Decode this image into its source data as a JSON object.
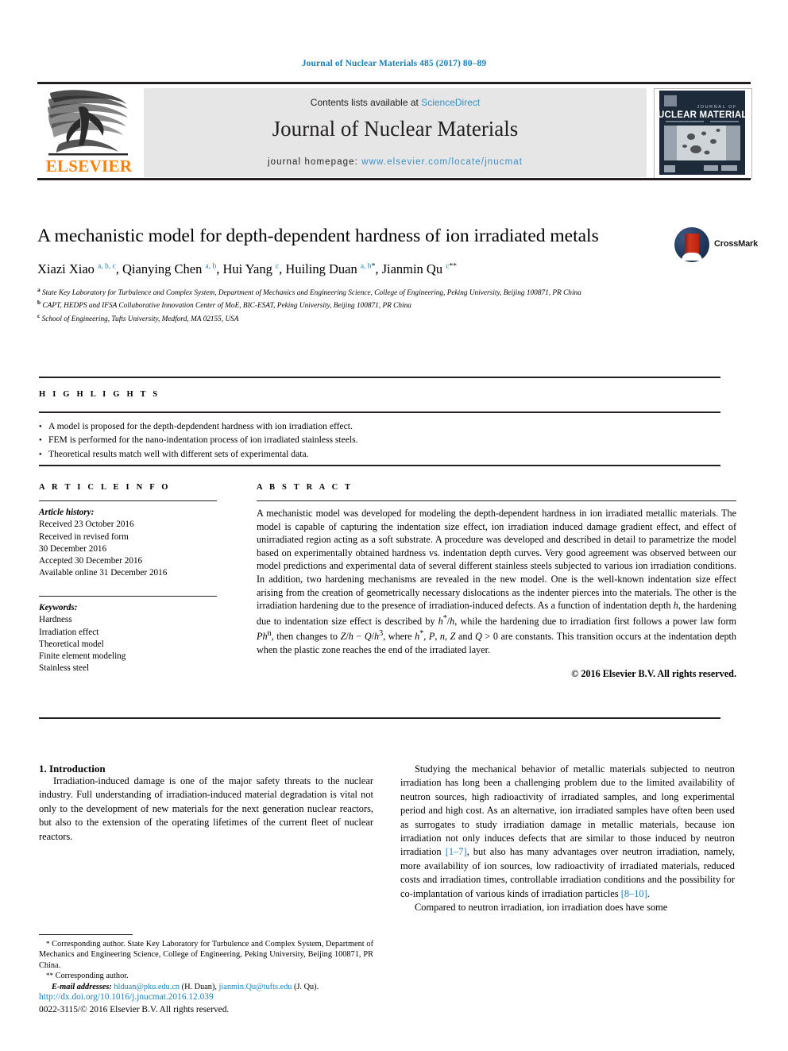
{
  "running_head": "Journal of Nuclear Materials 485 (2017) 80–89",
  "masthead": {
    "publisher_name": "ELSEVIER",
    "contents_prefix": "Contents lists available at ",
    "sciencedirect": "ScienceDirect",
    "journal_title": "Journal of Nuclear Materials",
    "homepage_prefix": "journal homepage: ",
    "homepage_url": "www.elsevier.com/locate/jnucmat",
    "cover_title_small": "JOURNAL OF",
    "cover_title_main": "NUCLEAR MATERIALS"
  },
  "article": {
    "title": "A mechanistic model for depth-dependent hardness of ion irradiated metals",
    "crossmark_label": "CrossMark",
    "authors_html": "Xiazi Xiao <sup>a, b, c</sup>, Qianying Chen <sup>a, b</sup>, Hui Yang <sup>c</sup>, Huiling Duan <sup>a, b</sup><sup class=\"star\">*</sup>, Jianmin Qu <sup>c</sup><sup class=\"star\">**</sup>",
    "affiliations": [
      {
        "mark": "a",
        "text": "State Key Laboratory for Turbulence and Complex System, Department of Mechanics and Engineering Science, College of Engineering, Peking University, Beijing 100871, PR China"
      },
      {
        "mark": "b",
        "text": "CAPT, HEDPS and IFSA Collaborative Innovation Center of MoE, BIC-ESAT, Peking University, Beijing 100871, PR China"
      },
      {
        "mark": "c",
        "text": "School of Engineering, Tufts University, Medford, MA 02155, USA"
      }
    ]
  },
  "highlights": {
    "label": "H I G H L I G H T S",
    "items": [
      "A model is proposed for the depth-depdendent hardness with ion irradiation effect.",
      "FEM is performed for the nano-indentation process of ion irradiated stainless steels.",
      "Theoretical results match well with different sets of experimental data."
    ]
  },
  "article_info": {
    "label": "A R T I C L E   I N F O",
    "history_label": "Article history:",
    "history": [
      "Received 23 October 2016",
      "Received in revised form",
      "30 December 2016",
      "Accepted 30 December 2016",
      "Available online 31 December 2016"
    ],
    "keywords_label": "Keywords:",
    "keywords": [
      "Hardness",
      "Irradiation effect",
      "Theoretical model",
      "Finite element modeling",
      "Stainless steel"
    ]
  },
  "abstract": {
    "label": "A B S T R A C T",
    "text_html": "A mechanistic model was developed for modeling the depth-dependent hardness in ion irradiated metallic materials. The model is capable of capturing the indentation size effect, ion irradiation induced damage gradient effect, and effect of unirradiated region acting as a soft substrate. A procedure was developed and described in detail to parametrize the model based on experimentally obtained hardness vs. indentation depth curves. Very good agreement was observed between our model predictions and experimental data of several different stainless steels subjected to various ion irradiation conditions. In addition, two hardening mechanisms are revealed in the new model. One is the well-known indentation size effect arising from the creation of geometrically necessary dislocations as the indenter pierces into the materials. The other is the irradiation hardening due to the presence of irradiation-induced defects. As a function of indentation depth <i>h</i>, the hardening due to indentation size effect is described by <i>h</i><sup>*</sup>/<i>h</i>, while the hardening due to irradiation first follows a power law form <i>Ph</i><sup>n</sup>, then changes to <i>Z</i>/<i>h</i> &minus; <i>Q</i>/<i>h</i><sup>3</sup>, where <i>h</i><sup>*</sup>, <i>P</i>, <i>n</i>, <i>Z</i> and <i>Q</i> &gt; 0 are constants. This transition occurs at the indentation depth when the plastic zone reaches the end of the irradiated layer.",
    "copyright": "© 2016 Elsevier B.V. All rights reserved."
  },
  "body": {
    "section_heading": "1.  Introduction",
    "left_paragraph": "Irradiation-induced damage is one of the major safety threats to the nuclear industry. Full understanding of irradiation-induced material degradation is vital not only to the development of new materials for the next generation nuclear reactors, but also to the extension of the operating lifetimes of the current fleet of nuclear reactors.",
    "right_paragraph_html": "Studying the mechanical behavior of metallic materials subjected to neutron irradiation has long been a challenging problem due to the limited availability of neutron sources, high radioactivity of irradiated samples, and long experimental period and high cost. As an alternative, ion irradiated samples have often been used as surrogates to study irradiation damage in metallic materials, because ion irradiation not only induces defects that are similar to those induced by neutron irradiation <span class=\"ref\">[1&ndash;7]</span>, but also has many advantages over neutron irradiation, namely, more availability of ion sources, low radioactivity of irradiated materials, reduced costs and irradiation times, controllable irradiation conditions and the possibility for co-implantation of various kinds of irradiation particles <span class=\"ref\">[8&ndash;10]</span>.",
    "right_paragraph_2": "Compared to neutron irradiation, ion irradiation does have some"
  },
  "footnotes": {
    "corresponding_1_html": "<span class=\"mark\">*</span> Corresponding author. State Key Laboratory for Turbulence and Complex System, Department of Mechanics and Engineering Science, College of Engineering, Peking University, Beijing 100871, PR China.",
    "corresponding_2_html": "<span class=\"mark\">**</span> Corresponding author.",
    "emails_label": "E-mail addresses:",
    "email_1": "hlduan@pku.edu.cn",
    "email_1_person": "(H. Duan)",
    "email_2": "jianmin.Qu@tufts.edu",
    "email_2_person": "(J. Qu)."
  },
  "bottom": {
    "doi": "http://dx.doi.org/10.1016/j.jnucmat.2016.12.039",
    "issn_line": "0022-3115/© 2016 Elsevier B.V. All rights reserved."
  },
  "colors": {
    "link": "#1a7fb5",
    "sciencedirect": "#3a8fc4",
    "elsevier_orange": "#ff8000",
    "banner_bg": "#e6e6e6",
    "rule": "#231f20"
  }
}
